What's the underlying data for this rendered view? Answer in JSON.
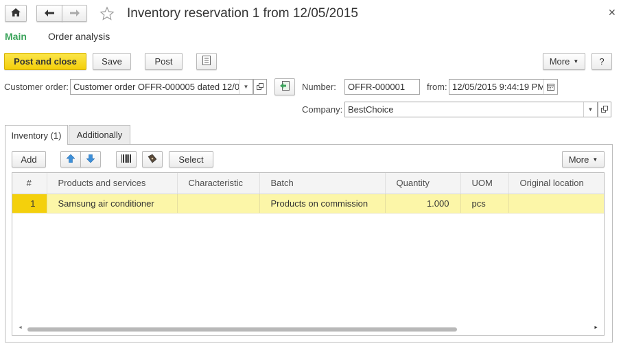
{
  "window": {
    "title": "Inventory reservation 1 from 12/05/2015"
  },
  "nav_tabs": [
    {
      "label": "Main"
    },
    {
      "label": "Order analysis"
    }
  ],
  "toolbar": {
    "post_and_close": "Post and close",
    "save": "Save",
    "post": "Post",
    "more": "More",
    "help": "?"
  },
  "form": {
    "customer_order_label": "Customer order:",
    "customer_order_value": "Customer order OFFR-000005 dated 12/0",
    "number_label": "Number:",
    "number_value": "OFFR-000001",
    "from_label": "from:",
    "from_value": "12/05/2015  9:44:19 PM",
    "company_label": "Company:",
    "company_value": "BestChoice"
  },
  "tabs": [
    {
      "label": "Inventory (1)"
    },
    {
      "label": "Additionally"
    }
  ],
  "table_toolbar": {
    "add": "Add",
    "select": "Select",
    "more": "More"
  },
  "table": {
    "columns": [
      "#",
      "Products and services",
      "Characteristic",
      "Batch",
      "Quantity",
      "UOM",
      "Original location"
    ],
    "rows": [
      {
        "num": "1",
        "product": "Samsung air conditioner",
        "characteristic": "",
        "batch": "Products on commission",
        "quantity": "1.000",
        "uom": "pcs",
        "location": ""
      }
    ]
  },
  "colors": {
    "accent_green": "#3aa35a",
    "primary_yellow": "#f4d00c",
    "row_highlight": "#fcf6a8",
    "arrow_blue": "#3d8fd8"
  }
}
